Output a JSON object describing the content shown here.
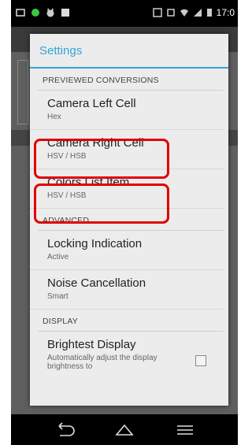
{
  "statusbar": {
    "time": "17:0"
  },
  "dialog": {
    "title": "Settings",
    "sections": [
      {
        "header": "PREVIEWED CONVERSIONS"
      },
      {
        "header": "ADVANCED"
      },
      {
        "header": "DISPLAY"
      }
    ],
    "prefs": {
      "camera_left": {
        "title": "Camera Left Cell",
        "summary": "Hex"
      },
      "camera_right": {
        "title": "Camera Right Cell",
        "summary": "HSV / HSB"
      },
      "colors_list": {
        "title": "Colors List Item",
        "summary": "HSV / HSB"
      },
      "locking": {
        "title": "Locking Indication",
        "summary": "Active"
      },
      "noise": {
        "title": "Noise Cancellation",
        "summary": "Smart"
      },
      "brightest": {
        "title": "Brightest Display",
        "summary": "Automatically adjust the display brightness to",
        "checked": false
      }
    }
  },
  "colors": {
    "accent": "#33a3d6",
    "highlight": "#e00000"
  },
  "navbar": {
    "icons": [
      "back-icon",
      "home-icon",
      "menu-icon"
    ]
  }
}
